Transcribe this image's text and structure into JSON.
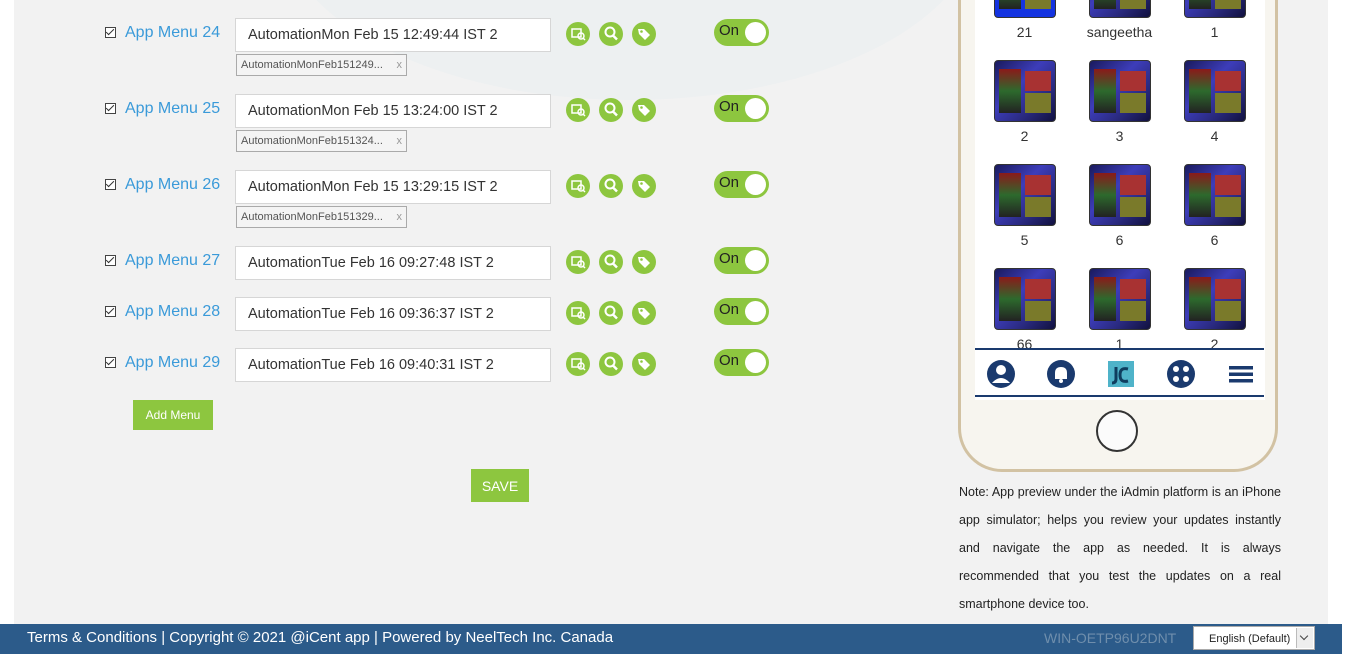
{
  "menus": [
    {
      "label": "App Menu 24",
      "value": "AutomationMon Feb 15 12:49:44 IST 2",
      "tag": "AutomationMonFeb151249...",
      "toggle": "On",
      "checked": true
    },
    {
      "label": "App Menu 25",
      "value": "AutomationMon Feb 15 13:24:00 IST 2",
      "tag": "AutomationMonFeb151324...",
      "toggle": "On",
      "checked": true
    },
    {
      "label": "App Menu 26",
      "value": "AutomationMon Feb 15 13:29:15 IST 2",
      "tag": "AutomationMonFeb151329...",
      "toggle": "On",
      "checked": true
    },
    {
      "label": "App Menu 27",
      "value": "AutomationTue Feb 16 09:27:48 IST 2",
      "tag": "",
      "toggle": "On",
      "checked": true
    },
    {
      "label": "App Menu 28",
      "value": "AutomationTue Feb 16 09:36:37 IST 2",
      "tag": "",
      "toggle": "On",
      "checked": true
    },
    {
      "label": "App Menu 29",
      "value": "AutomationTue Feb 16 09:40:31 IST 2",
      "tag": "",
      "toggle": "On",
      "checked": true
    }
  ],
  "tag_remove": "x",
  "actions": {
    "add_menu": "Add Menu",
    "save": "SAVE"
  },
  "phone": {
    "grid_labels": [
      "21",
      "sangeetha",
      "1",
      "2",
      "3",
      "4",
      "5",
      "6",
      "6",
      "66",
      "1",
      "2"
    ],
    "tabs": [
      "profile-icon",
      "bell-icon",
      "app-logo-icon",
      "apps-icon",
      "menu-icon"
    ]
  },
  "note": "Note: App preview under the iAdmin platform is an iPhone app simulator; helps you review your updates instantly and navigate the app as needed. It is always recommended that you test the updates on a real smartphone device too.",
  "footer": {
    "text": "Terms & Conditions | Copyright © 2021 @iCent app | Powered by NeelTech Inc. Canada",
    "host": "WIN-OETP96U2DNT",
    "language": "English (Default)"
  },
  "colors": {
    "accent_green": "#8dc63f",
    "link_blue": "#3a9ad9",
    "footer_blue": "#2c5b8a",
    "tabbar_navy": "#1a3a6e"
  }
}
